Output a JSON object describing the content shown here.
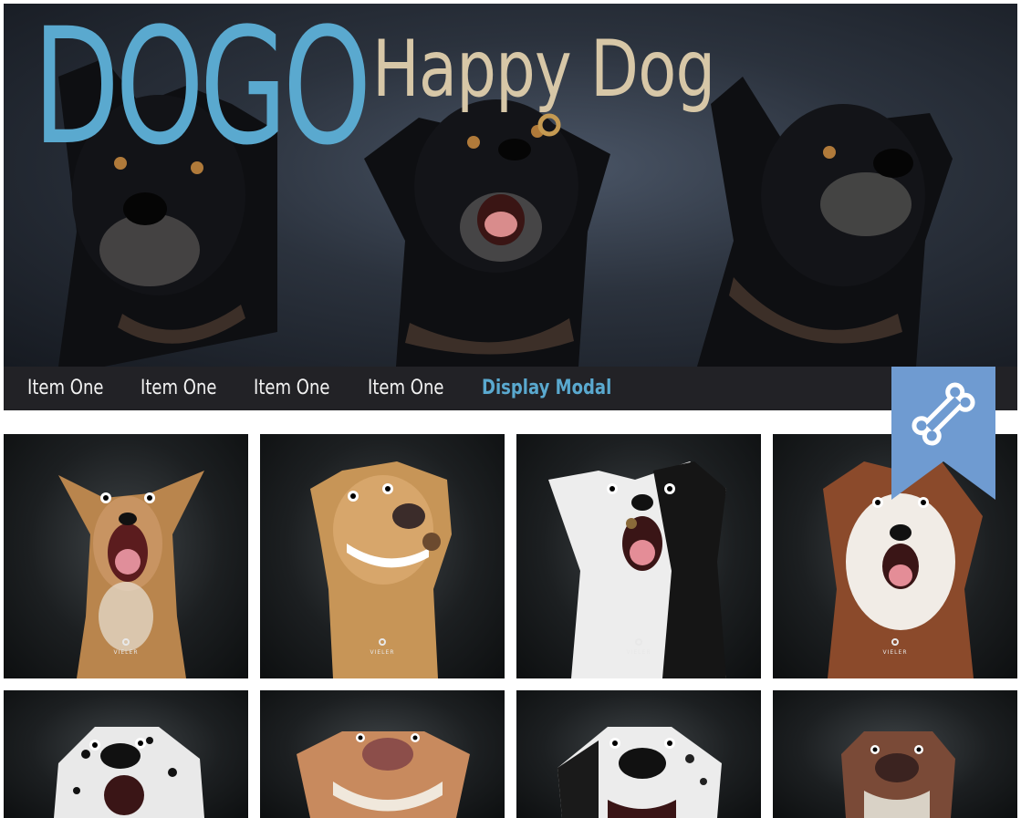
{
  "hero": {
    "brand": "DOGO",
    "tagline": "Happy Dog"
  },
  "nav": {
    "items": [
      {
        "label": "Item One"
      },
      {
        "label": "Item One"
      },
      {
        "label": "Item One"
      },
      {
        "label": "Item One"
      },
      {
        "label": "Display Modal"
      }
    ]
  },
  "ribbon": {
    "icon": "bone-icon",
    "color": "#6f9bd1"
  },
  "gallery": {
    "watermark": "VIELER",
    "tiles": [
      {
        "name": "dog-photo-1"
      },
      {
        "name": "dog-photo-2"
      },
      {
        "name": "dog-photo-3"
      },
      {
        "name": "dog-photo-4"
      },
      {
        "name": "dog-photo-5"
      },
      {
        "name": "dog-photo-6"
      },
      {
        "name": "dog-photo-7"
      },
      {
        "name": "dog-photo-8"
      }
    ]
  },
  "colors": {
    "brand_blue": "#5aa9cf",
    "tagline_beige": "#d7c7a7",
    "nav_bg": "#222226",
    "ribbon_blue": "#6f9bd1"
  }
}
